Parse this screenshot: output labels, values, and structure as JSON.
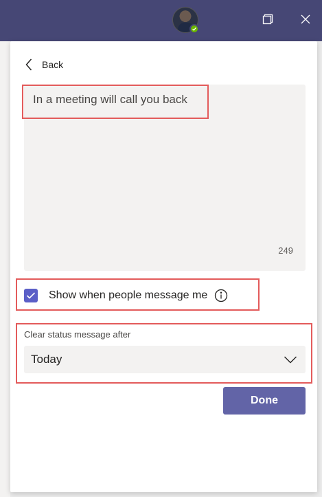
{
  "titlebar": {
    "avatar_icon": "user-avatar",
    "presence_icon": "available-check-icon",
    "presence_color": "#6bb700",
    "restore_icon": "restore-window-icon",
    "close_icon": "close-icon",
    "background_color": "#464775"
  },
  "status_panel": {
    "back_label": "Back",
    "message": "In a meeting will call you back",
    "char_count": "249",
    "show_when_messaged": {
      "label": "Show when people message me",
      "checked": true
    },
    "clear_after": {
      "label": "Clear status message after",
      "value": "Today"
    },
    "done_label": "Done",
    "accent_color": "#6264a7",
    "highlight_color": "#e35b5b"
  }
}
